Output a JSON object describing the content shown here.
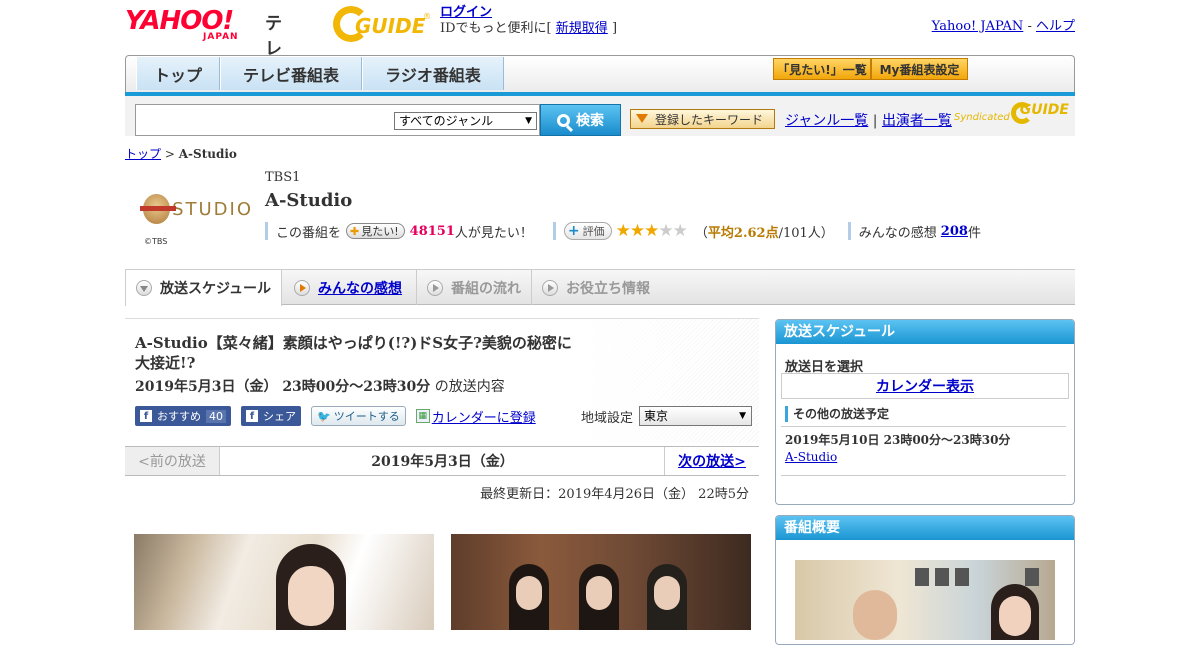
{
  "header": {
    "logo_yahoo": "YAHOO!",
    "logo_japan": "JAPAN",
    "logo_tv": "テレビ",
    "gguide_text": "GUIDE",
    "gguide_reg": "®",
    "login_label": "ログイン",
    "login_prompt": "IDでもっと便利に[",
    "signup_label": "新規取得",
    "signup_close": "]",
    "yahoo_japan_link": "Yahoo! JAPAN",
    "separator": "-",
    "help_link": "ヘルプ"
  },
  "nav": {
    "tabs": [
      {
        "label": "トップ"
      },
      {
        "label": "テレビ番組表"
      },
      {
        "label": "ラジオ番組表"
      }
    ],
    "mitai_list": "「見たい!」一覧",
    "my_schedule": "My番組表設定"
  },
  "search": {
    "query": "",
    "genre_selected": "すべてのジャンル",
    "search_button": "検索",
    "keyword_button": "登録したキーワード",
    "genre_list_link": "ジャンル一覧",
    "link_separator": "|",
    "cast_list_link": "出演者一覧",
    "syndicated": "Syndicated",
    "syndicated_brand": "GUIDE"
  },
  "breadcrumb": {
    "top": "トップ",
    "sep": ">",
    "current": "A-Studio"
  },
  "program": {
    "logo_text": "STUDIO",
    "copyright": "©TBS",
    "channel": "TBS1",
    "title": "A-Studio",
    "mitai_prefix": "この番組を",
    "mitai_button": "見たい!",
    "mitai_count": "48151",
    "mitai_suffix": "人が見たい！",
    "rating_button": "評価",
    "rating_avg_label": "平均2.62点",
    "rating_open": "（",
    "rating_count": "/101人）",
    "impressions_label": "みんなの感想",
    "impressions_count": "208",
    "impressions_suffix": "件"
  },
  "subnav": {
    "tabs": [
      {
        "label": "放送スケジュール",
        "state": "active"
      },
      {
        "label": "みんなの感想",
        "state": "link"
      },
      {
        "label": "番組の流れ",
        "state": "disabled"
      },
      {
        "label": "お役立ち情報",
        "state": "disabled"
      }
    ]
  },
  "episode": {
    "title": "A-Studio【菜々緒】素顔はやっぱり(!?)ドS女子?美貌の秘密に大接近!?",
    "datetime": "2019年5月3日（金） 23時00分～23時30分",
    "datetime_suffix": "の放送内容",
    "fb_recommend": "おすすめ",
    "fb_count": "40",
    "fb_share": "シェア",
    "tweet": "ツイートする",
    "calendar_register": "カレンダーに登録",
    "region_label": "地域設定",
    "region_selected": "東京"
  },
  "datebar": {
    "prev": "<前の放送",
    "current": "2019年5月3日（金）",
    "next": "次の放送>"
  },
  "updated": "最終更新日：2019年4月26日（金） 22時5分",
  "sidebar": {
    "schedule_header": "放送スケジュール",
    "select_date": "放送日を選択",
    "calendar_button": "カレンダー表示",
    "other_header": "その他の放送予定",
    "other_datetime": "2019年5月10日 23時00分～23時30分",
    "other_link": "A-Studio",
    "overview_header": "番組概要"
  },
  "colors": {
    "accent_blue": "#1a9ad6",
    "yahoo_red": "#ff0033",
    "gguide_yellow": "#f2b705",
    "star": "#f0a800",
    "pink": "#e6005c"
  },
  "rating": {
    "value": 2.62,
    "max": 5
  }
}
